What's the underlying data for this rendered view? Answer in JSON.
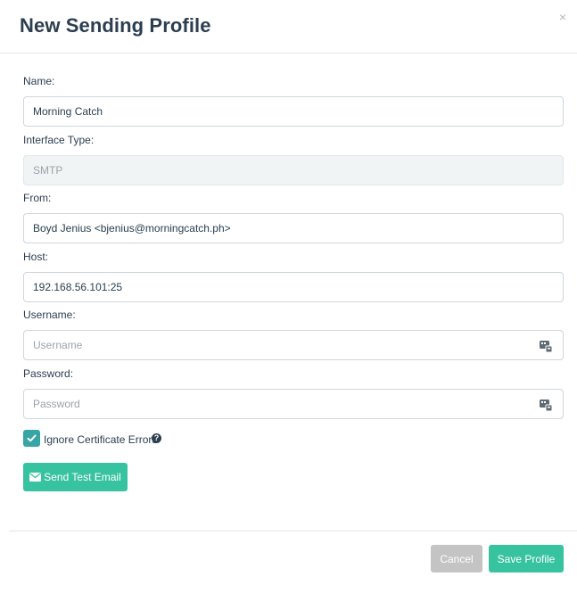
{
  "modal": {
    "title": "New Sending Profile",
    "close_symbol": "×"
  },
  "form": {
    "name_label": "Name:",
    "name_value": "Morning Catch",
    "interface_label": "Interface Type:",
    "interface_value": "SMTP",
    "from_label": "From:",
    "from_value": "Boyd Jenius <bjenius@morningcatch.ph>",
    "host_label": "Host:",
    "host_value": "192.168.56.101:25",
    "username_label": "Username:",
    "username_placeholder": "Username",
    "password_label": "Password:",
    "password_placeholder": "Password",
    "ignore_cert_label": "Ignore Certificate Errors",
    "ignore_cert_checked": true,
    "help_symbol": "?"
  },
  "buttons": {
    "send_test_email": "Send Test Email",
    "cancel": "Cancel",
    "save_profile": "Save Profile"
  },
  "colors": {
    "primary": "#37c2a0",
    "checkbox": "#38a5a5",
    "cancel": "#c4c4c4",
    "title": "#2c3e50"
  }
}
